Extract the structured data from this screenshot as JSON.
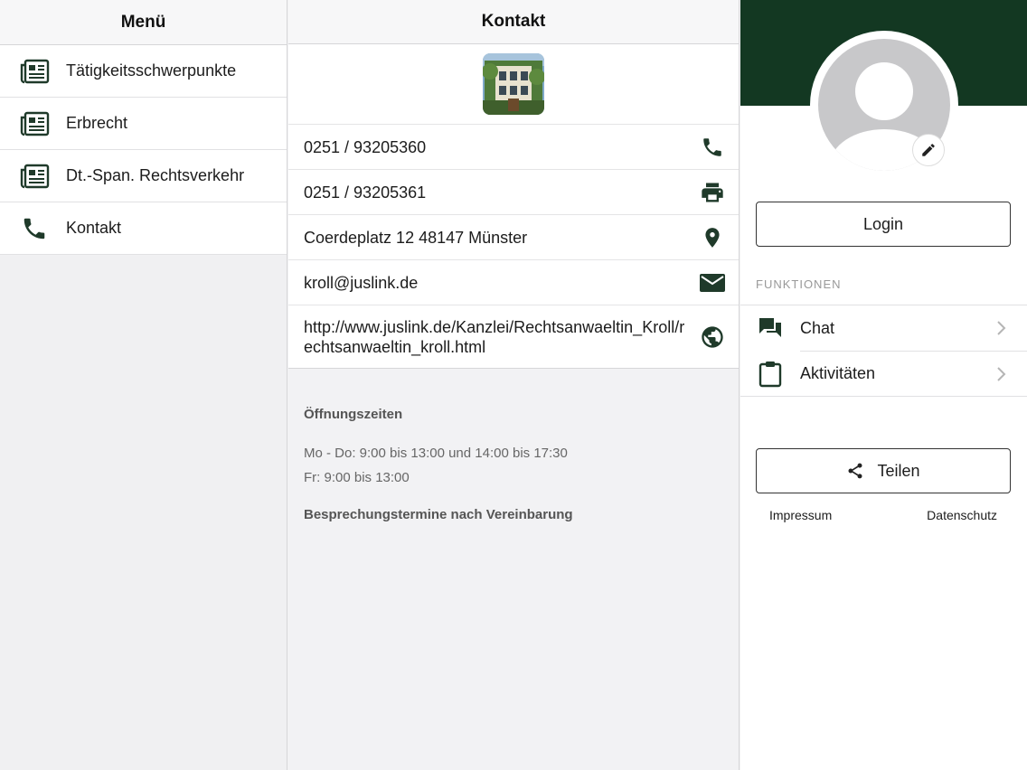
{
  "menu": {
    "title": "Menü",
    "items": [
      {
        "label": "Tätigkeitsschwerpunkte",
        "icon": "newspaper-icon"
      },
      {
        "label": "Erbrecht",
        "icon": "newspaper-icon"
      },
      {
        "label": "Dt.-Span. Rechtsverkehr",
        "icon": "newspaper-icon"
      },
      {
        "label": "Kontakt",
        "icon": "phone-icon"
      }
    ]
  },
  "contact": {
    "title": "Kontakt",
    "phone": "0251 / 93205360",
    "fax": "0251 / 93205361",
    "address": "Coerdeplatz 12 48147 Münster",
    "email": "kroll@juslink.de",
    "website": "http://www.juslink.de/Kanzlei/Rechtsanwaeltin_Kroll/rechtsanwaeltin_kroll.html"
  },
  "hours": {
    "title": "Öffnungszeiten",
    "lines": [
      "Mo - Do: 9:00 bis 13:00 und 14:00 bis 17:30",
      "Fr: 9:00 bis 13:00"
    ],
    "note": "Besprechungstermine nach Vereinbarung"
  },
  "side": {
    "login_label": "Login",
    "section_label": "FUNKTIONEN",
    "functions": [
      {
        "label": "Chat",
        "icon": "chat-icon"
      },
      {
        "label": "Aktivitäten",
        "icon": "clipboard-icon"
      }
    ],
    "share_label": "Teilen",
    "imprint_label": "Impressum",
    "privacy_label": "Datenschutz"
  },
  "colors": {
    "brand": "#133822",
    "icon": "#1f3a2a"
  }
}
